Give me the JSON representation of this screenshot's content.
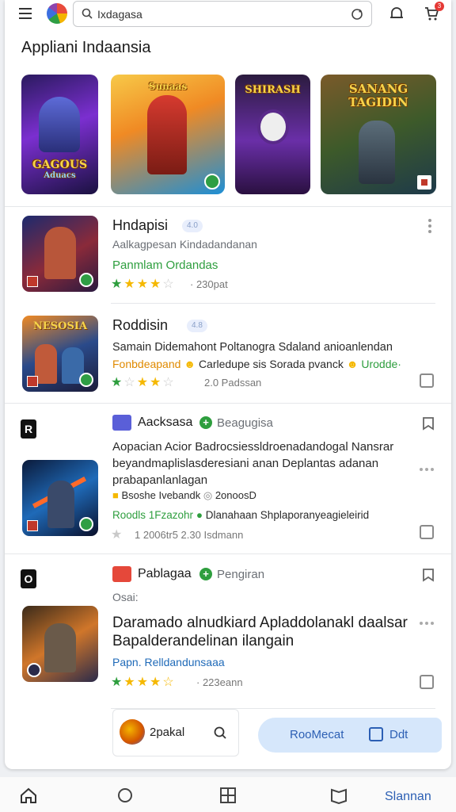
{
  "header": {
    "search_value": "Ixdagasa",
    "cart_count": "3"
  },
  "section": {
    "title": "Appliani Indaansia"
  },
  "featured": [
    {
      "name": "game-1",
      "text": "GAGOUS",
      "subtext": "Aduacs"
    },
    {
      "name": "game-2",
      "text": "Sunaas",
      "subtext": ""
    },
    {
      "name": "game-3",
      "text": "SHIRASH",
      "subtext": ""
    },
    {
      "name": "game-4",
      "text": "SANANG TAGIDIN",
      "subtext": ""
    }
  ],
  "items": [
    {
      "title": "Hndapisi",
      "pill": "4.0",
      "subtitle": "Aalkagpesan  Kindadandanan",
      "category": "Panmlam  Ordandas",
      "rating": 3.5,
      "count": "· 230pat"
    },
    {
      "title": "Roddisin",
      "pill": "4.8",
      "thumb_text": "NESOSIA",
      "line1": "Samain  Didemahont  Poltanogra Sdaland anioanlendan",
      "line2_a": "Fonbdeapand",
      "line2_b": "Carledupe sis  Sorada  pvanck",
      "line2_c": "Urodde·",
      "rating": 2.5,
      "count": "2.0 Padssan"
    },
    {
      "side_letter": "R",
      "title": "Aacksasa",
      "title2": "Beagugisa",
      "desc": "Aopacian  Acior  Badrocsiessldroenadandogal  Nansrar beyandmaplislasderesiani anan Deplantas adanan prabapanlanlagan",
      "meta": "Bsoshe Ivebandk",
      "meta2": "2onoosD",
      "green_line": "Roodls 1Fzazohr",
      "green_line2": "Dlanahaan  Shplaporanyeagieleirid",
      "rating": 1.0,
      "count": "1   2006tr5  2.30 Isdmann"
    },
    {
      "side_letter": "O",
      "title": "Pablagaa",
      "title2": "Pengiran",
      "meta": "Osai:",
      "headline": "Daramado  alnudkiard  Apladdolanakl  daalsar Bapalderandelinan  ilangain",
      "green_line": "Papn.  Relldandunsaaa",
      "rating": 3.5,
      "count": "· 223eann"
    }
  ],
  "bottom_strip": {
    "mini_label": "2pakal",
    "cta_label": "RooMecat",
    "cta_label2": "Ddt"
  },
  "nav": {
    "active_label": "Slannan"
  },
  "colors": {
    "accent": "#2c5fb4",
    "green": "#2e9e3e",
    "star": "#f5b800"
  }
}
